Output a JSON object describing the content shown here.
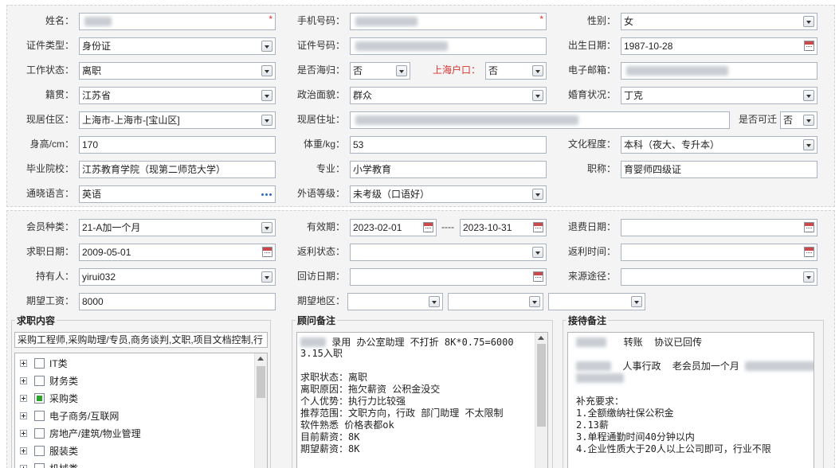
{
  "personal": {
    "name_label": "姓名：",
    "phone_label": "手机号码：",
    "gender_label": "性别：",
    "gender_value": "女",
    "id_type_label": "证件类型：",
    "id_type_value": "身份证",
    "id_number_label": "证件号码：",
    "birth_label": "出生日期：",
    "birth_value": "1987-10-28",
    "work_status_label": "工作状态：",
    "work_status_value": "离职",
    "overseas_label": "是否海归：",
    "overseas_value": "否",
    "hukou_label": "上海户口：",
    "hukou_value": "否",
    "email_label": "电子邮箱：",
    "native_label": "籍贯：",
    "native_value": "江苏省",
    "political_label": "政治面貌：",
    "political_value": "群众",
    "marital_label": "婚育状况：",
    "marital_value": "丁克",
    "district_label": "现居住区：",
    "district_value": "上海市-上海市-[宝山区]",
    "address_label": "现居住址：",
    "relocate_label": "是否可迁",
    "relocate_value": "否",
    "height_label": "身高/cm：",
    "height_value": "170",
    "weight_label": "体重/kg：",
    "weight_value": "53",
    "education_label": "文化程度：",
    "education_value": "本科（夜大、专升本）",
    "school_label": "毕业院校：",
    "school_value": "江苏教育学院（现第二师范大学）",
    "major_label": "专业：",
    "major_value": "小学教育",
    "title_label": "职称：",
    "title_value": "育婴师四级证",
    "language_label": "通晓语言：",
    "language_value": "英语",
    "foreign_level_label": "外语等级：",
    "foreign_level_value": "未考级（口语好）"
  },
  "membership": {
    "member_type_label": "会员种类：",
    "member_type_value": "21-A加一个月",
    "valid_label": "有效期：",
    "valid_from": "2023-02-01",
    "valid_sep": "----",
    "valid_to": "2023-10-31",
    "refund_date_label": "退费日期：",
    "job_date_label": "求职日期：",
    "job_date_value": "2009-05-01",
    "rebate_status_label": "返利状态：",
    "rebate_time_label": "返利时间：",
    "holder_label": "持有人：",
    "holder_value": "yirui032",
    "visit_date_label": "回访日期：",
    "source_label": "来源途径：",
    "salary_label": "期望工资：",
    "salary_value": "8000",
    "area_label": "期望地区："
  },
  "job_content": {
    "title": "求职内容",
    "summary": "采购工程师,采购助理/专员,商务谈判,文职,项目文档控制,行",
    "categories": [
      {
        "label": "IT类",
        "checked": false
      },
      {
        "label": "财务类",
        "checked": false
      },
      {
        "label": "采购类",
        "checked": true
      },
      {
        "label": "电子商务/互联网",
        "checked": false
      },
      {
        "label": "房地产/建筑/物业管理",
        "checked": false
      },
      {
        "label": "服装类",
        "checked": false
      },
      {
        "label": "机械类",
        "checked": false
      }
    ]
  },
  "advisor_notes": {
    "title": "顾问备注",
    "line1": "录用 办公室助理 不打折 8K*0.75=6000",
    "line2": "3.15入职",
    "line3": "",
    "line4": "求职状态：离职",
    "line5": "离职原因：拖欠薪资 公积金没交",
    "line6": "个人优势：执行力比较强",
    "line7": "推荐范围：文职方向，行政 部门助理 不太限制",
    "line8": "软件熟悉 价格表都ok",
    "line9": "目前薪资：8K",
    "line10": "期望薪资：8K"
  },
  "reception_notes": {
    "title": "接待备注",
    "line1": "转账  协议已回传",
    "line2": "",
    "line3": "人事行政  老会员加一个月",
    "line4": "",
    "line5": "",
    "line6": "补充要求：",
    "line7": "1.全额缴纳社保公积金",
    "line8": "2.13薪",
    "line9": "3.单程通勤时间40分钟以内",
    "line10": "4.企业性质大于20人以上公司即可，行业不限"
  },
  "colors": {
    "panel_bg": "#f4f4f4",
    "field_border": "#a9b4c0",
    "required_star": "#d9322d",
    "checked_green": "#29a329",
    "link_blue": "#2f6fc4"
  }
}
